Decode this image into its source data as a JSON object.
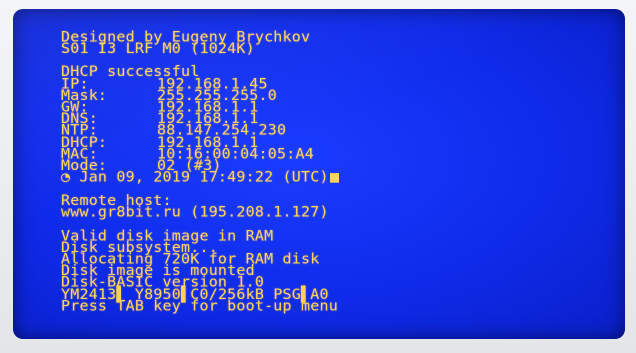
{
  "header": {
    "line1": "Designed by Eugeny Brychkov",
    "line2": "S01 I3 LRF M0 (1024K)"
  },
  "network": {
    "status": "DHCP successful",
    "rows": [
      {
        "label": "IP:",
        "value": "192.168.1.45"
      },
      {
        "label": "Mask:",
        "value": "255.255.255.0"
      },
      {
        "label": "GW:",
        "value": "192.168.1.1"
      },
      {
        "label": "DNS:",
        "value": "192.168.1.1"
      },
      {
        "label": "NTP:",
        "value": "88.147.254.230"
      },
      {
        "label": "DHCP:",
        "value": "192.168.1.1"
      },
      {
        "label": "MAC:",
        "value": "10:16:00:04:05:A4"
      },
      {
        "label": "Mode:",
        "value": "02 (#3)"
      }
    ],
    "clock_icon": "clock-icon",
    "datetime": "Jan 09, 2019 17:49:22 (UTC)"
  },
  "remote": {
    "title": "Remote host:",
    "host": "www.gr8bit.ru (195.208.1.127)"
  },
  "boot": {
    "lines": [
      "Valid disk image in RAM",
      "Disk subsystem...",
      "Allocating 720K for RAM disk",
      "Disk image is mounted",
      "Disk-BASIC version 1.0"
    ],
    "chips_a": "YM2413",
    "chips_b": "Y8950",
    "chips_c": "C0/256kB PSG",
    "chips_d": "A0",
    "prompt": "Press TAB key for boot-up menu"
  },
  "colors": {
    "screen": "#0f2bea",
    "text": "#ffd25a"
  }
}
